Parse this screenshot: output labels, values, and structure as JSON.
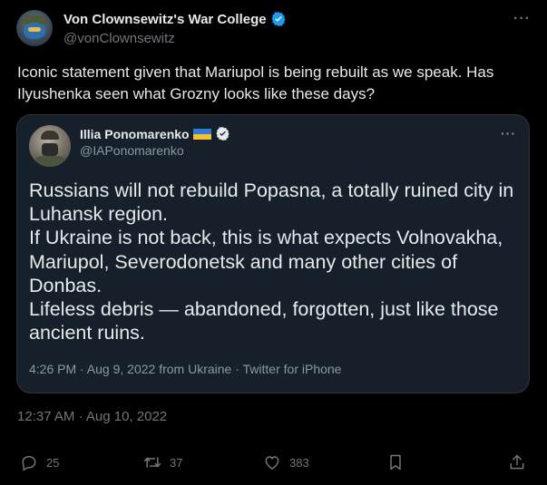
{
  "author": {
    "display_name": "Von Clownsewitz's War College",
    "handle": "@vonClownsewitz"
  },
  "tweet": {
    "text": "Iconic statement given that Mariupol is being rebuilt as we speak. Has Ilyushenka seen what Grozny looks like these days?",
    "timestamp": "12:37 AM · Aug 10, 2022"
  },
  "quoted": {
    "display_name": "Illia Ponomarenko",
    "handle": "@IAPonomarenko",
    "text": "Russians will not rebuild Popasna, a totally ruined city in Luhansk region.\nIf Ukraine is not back, this is what expects Volnovakha, Mariupol, Severodonetsk and many other cities of Donbas.\nLifeless debris — abandoned, forgotten, just like those ancient ruins.",
    "meta": "4:26 PM · Aug 9, 2022 from Ukraine · Twitter for iPhone"
  },
  "actions": {
    "replies": "25",
    "retweets": "37",
    "likes": "383"
  },
  "icons": {
    "verified": "verified-badge-icon",
    "more": "more-dots-icon",
    "reply": "reply-icon",
    "retweet": "retweet-icon",
    "like": "heart-icon",
    "bookmark": "bookmark-icon",
    "share": "share-icon",
    "flag": "ukraine-flag-icon"
  },
  "colors": {
    "background": "#000000",
    "quote_background": "#15202b",
    "verified_blue": "#1d9bf0",
    "muted": "#71767b"
  }
}
